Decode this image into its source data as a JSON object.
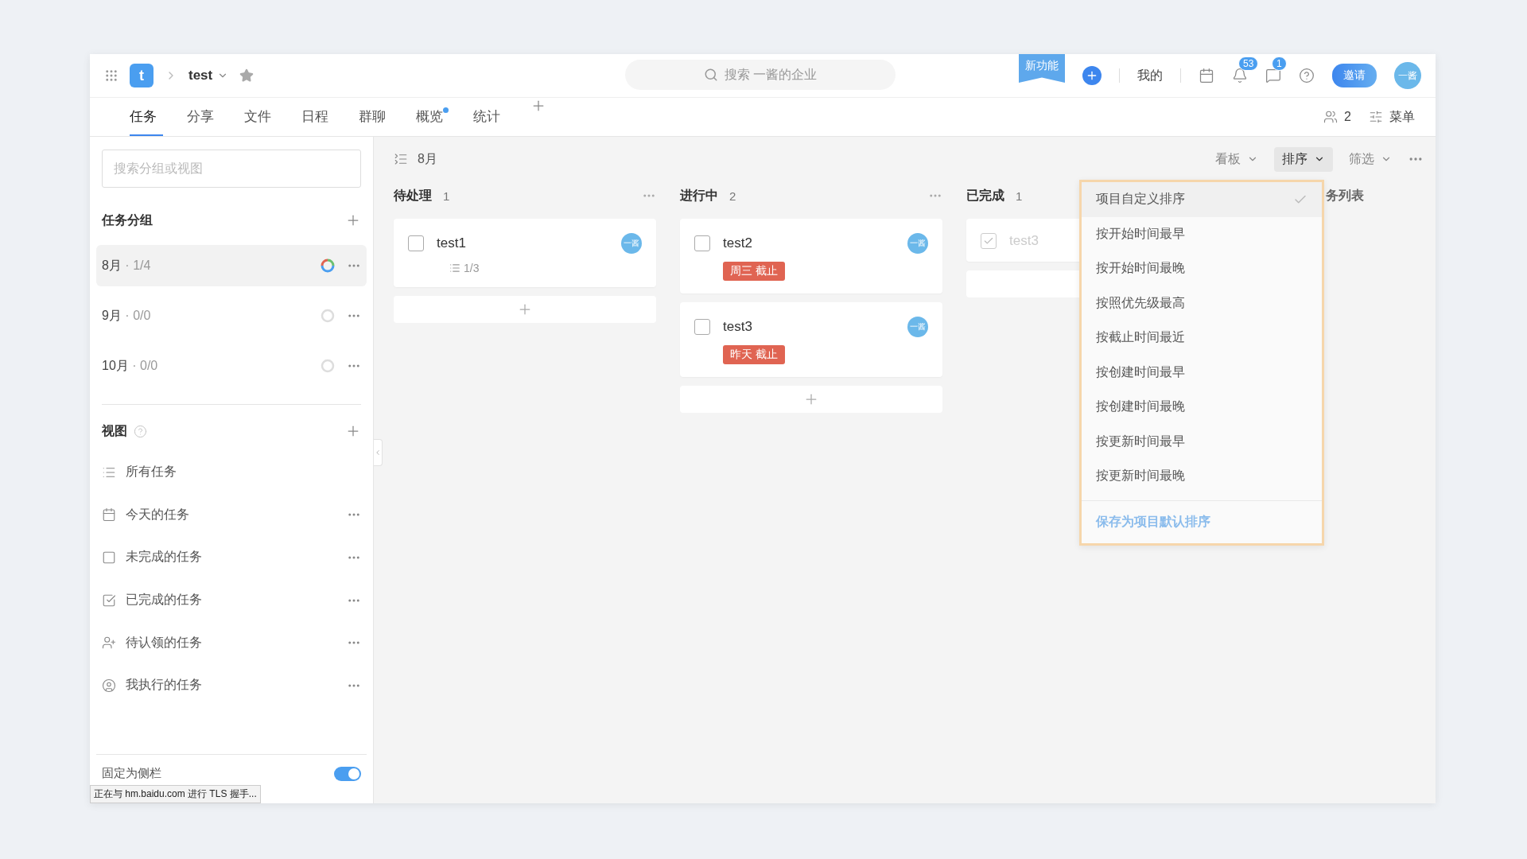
{
  "header": {
    "logo": "t",
    "project": "test",
    "search_placeholder": "搜索 一酱的企业",
    "new_feature": "新功能",
    "mine": "我的",
    "notifications": "53",
    "messages": "1",
    "invite": "邀请",
    "avatar": "一酱"
  },
  "tabs": [
    {
      "label": "任务",
      "selected": true,
      "dot": false
    },
    {
      "label": "分享",
      "selected": false,
      "dot": false
    },
    {
      "label": "文件",
      "selected": false,
      "dot": false
    },
    {
      "label": "日程",
      "selected": false,
      "dot": false
    },
    {
      "label": "群聊",
      "selected": false,
      "dot": false
    },
    {
      "label": "概览",
      "selected": false,
      "dot": true
    },
    {
      "label": "统计",
      "selected": false,
      "dot": false
    }
  ],
  "members": "2",
  "menu": "菜单",
  "sidebar": {
    "search_placeholder": "搜索分组或视图",
    "groups_title": "任务分组",
    "groups": [
      {
        "name": "8月",
        "count": "· 1/4",
        "selected": true,
        "kind": "progress"
      },
      {
        "name": "9月",
        "count": "· 0/0",
        "selected": false,
        "kind": "empty"
      },
      {
        "name": "10月",
        "count": "· 0/0",
        "selected": false,
        "kind": "empty"
      }
    ],
    "views_title": "视图",
    "views": [
      {
        "kind": "list",
        "label": "所有任务",
        "has_menu": false
      },
      {
        "kind": "calendar",
        "label": "今天的任务",
        "has_menu": true
      },
      {
        "kind": "open",
        "label": "未完成的任务",
        "has_menu": true
      },
      {
        "kind": "done",
        "label": "已完成的任务",
        "has_menu": true
      },
      {
        "kind": "unclaimed",
        "label": "待认领的任务",
        "has_menu": true
      },
      {
        "kind": "mine",
        "label": "我执行的任务",
        "has_menu": true
      }
    ],
    "pin": {
      "label": "固定为侧栏",
      "on": true
    }
  },
  "board": {
    "group_title": "8月",
    "view_buttons": [
      {
        "label": "看板",
        "selected": false
      },
      {
        "label": "排序",
        "selected": true
      },
      {
        "label": "筛选",
        "selected": false
      }
    ],
    "columns": [
      {
        "kind": "full",
        "title": "待处理",
        "count": "1",
        "tasks": [
          {
            "title": "test1",
            "done": false,
            "avatar": "一酱",
            "subtasks": "1/3"
          }
        ]
      },
      {
        "kind": "full",
        "title": "进行中",
        "count": "2",
        "tasks": [
          {
            "title": "test2",
            "done": false,
            "avatar": "一酱",
            "due": "周三 截止"
          },
          {
            "title": "test3",
            "done": false,
            "avatar": "一酱",
            "due": "昨天 截止"
          }
        ]
      },
      {
        "kind": "full",
        "title": "已完成",
        "count": "1",
        "tasks": [
          {
            "title": "test3",
            "done": true
          }
        ]
      },
      {
        "kind": "cut",
        "title": "务列表"
      }
    ]
  },
  "sort_menu": {
    "options": [
      {
        "label": "项目自定义排序",
        "selected": true
      },
      {
        "label": "按开始时间最早",
        "selected": false
      },
      {
        "label": "按开始时间最晚",
        "selected": false
      },
      {
        "label": "按照优先级最高",
        "selected": false
      },
      {
        "label": "按截止时间最近",
        "selected": false
      },
      {
        "label": "按创建时间最早",
        "selected": false
      },
      {
        "label": "按创建时间最晚",
        "selected": false
      },
      {
        "label": "按更新时间最早",
        "selected": false
      },
      {
        "label": "按更新时间最晚",
        "selected": false
      }
    ],
    "save": "保存为项目默认排序"
  },
  "status_text": "正在与 hm.baidu.com 进行 TLS 握手..."
}
